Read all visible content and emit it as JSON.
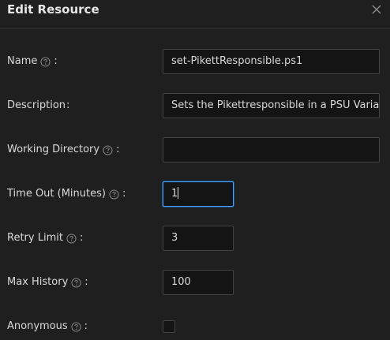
{
  "dialog": {
    "title": "Edit Resource",
    "close_icon": "close-icon"
  },
  "fields": {
    "name": {
      "label": "Name",
      "has_help": true,
      "colon": ":",
      "value": "set-PikettResponsible.ps1"
    },
    "description": {
      "label": "Description",
      "has_help": false,
      "colon": ":",
      "value": "Sets the Pikettresponsible in a PSU Variable"
    },
    "working_directory": {
      "label": "Working Directory",
      "has_help": true,
      "colon": ":",
      "value": ""
    },
    "timeout": {
      "label": "Time Out (Minutes)",
      "has_help": true,
      "colon": ":",
      "value": "1"
    },
    "retry_limit": {
      "label": "Retry Limit",
      "has_help": true,
      "colon": ":",
      "value": "3"
    },
    "max_history": {
      "label": "Max History",
      "has_help": true,
      "colon": ":",
      "value": "100"
    },
    "anonymous": {
      "label": "Anonymous",
      "has_help": true,
      "colon": ":",
      "checked": false
    }
  },
  "icons": {
    "help": "question-circle-icon",
    "close": "close-icon"
  },
  "colors": {
    "background": "#1f1f1f",
    "input_background": "#141414",
    "input_border": "#434343",
    "focus_border": "#4aa3ff",
    "text": "#d9d9d9"
  }
}
